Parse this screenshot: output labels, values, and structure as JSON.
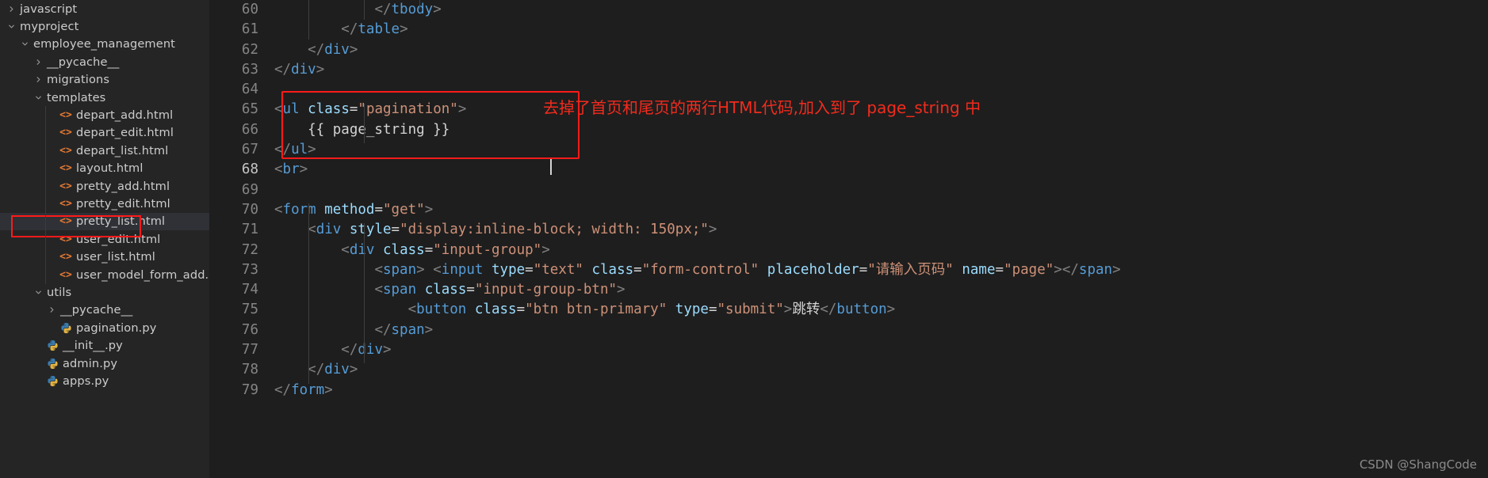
{
  "sidebar": {
    "items": [
      {
        "label": "javascript",
        "indent": 0,
        "twisty": "chevron-right-icon",
        "icon": "folder",
        "type": "folder",
        "selected": false
      },
      {
        "label": "myproject",
        "indent": 0,
        "twisty": "chevron-down-icon",
        "icon": "folder",
        "type": "folder",
        "selected": false
      },
      {
        "label": "employee_management",
        "indent": 1,
        "twisty": "chevron-down-icon",
        "icon": "folder",
        "type": "folder",
        "selected": false
      },
      {
        "label": "__pycache__",
        "indent": 2,
        "twisty": "chevron-right-icon",
        "icon": "folder",
        "type": "folder",
        "selected": false
      },
      {
        "label": "migrations",
        "indent": 2,
        "twisty": "chevron-right-icon",
        "icon": "folder",
        "type": "folder",
        "selected": false
      },
      {
        "label": "templates",
        "indent": 2,
        "twisty": "chevron-down-icon",
        "icon": "folder",
        "type": "folder",
        "selected": false
      },
      {
        "label": "depart_add.html",
        "indent": 3,
        "twisty": "none",
        "icon": "html-file-icon",
        "type": "html",
        "selected": false
      },
      {
        "label": "depart_edit.html",
        "indent": 3,
        "twisty": "none",
        "icon": "html-file-icon",
        "type": "html",
        "selected": false
      },
      {
        "label": "depart_list.html",
        "indent": 3,
        "twisty": "none",
        "icon": "html-file-icon",
        "type": "html",
        "selected": false
      },
      {
        "label": "layout.html",
        "indent": 3,
        "twisty": "none",
        "icon": "html-file-icon",
        "type": "html",
        "selected": false
      },
      {
        "label": "pretty_add.html",
        "indent": 3,
        "twisty": "none",
        "icon": "html-file-icon",
        "type": "html",
        "selected": false
      },
      {
        "label": "pretty_edit.html",
        "indent": 3,
        "twisty": "none",
        "icon": "html-file-icon",
        "type": "html",
        "selected": false
      },
      {
        "label": "pretty_list.html",
        "indent": 3,
        "twisty": "none",
        "icon": "html-file-icon",
        "type": "html",
        "selected": true
      },
      {
        "label": "user_edit.html",
        "indent": 3,
        "twisty": "none",
        "icon": "html-file-icon",
        "type": "html",
        "selected": false
      },
      {
        "label": "user_list.html",
        "indent": 3,
        "twisty": "none",
        "icon": "html-file-icon",
        "type": "html",
        "selected": false
      },
      {
        "label": "user_model_form_add.html",
        "indent": 3,
        "twisty": "none",
        "icon": "html-file-icon",
        "type": "html",
        "selected": false
      },
      {
        "label": "utils",
        "indent": 2,
        "twisty": "chevron-down-icon",
        "icon": "folder",
        "type": "folder",
        "selected": false
      },
      {
        "label": "__pycache__",
        "indent": 3,
        "twisty": "chevron-right-icon",
        "icon": "folder",
        "type": "folder",
        "selected": false
      },
      {
        "label": "pagination.py",
        "indent": 3,
        "twisty": "none",
        "icon": "python-file-icon",
        "type": "python",
        "selected": false
      },
      {
        "label": "__init__.py",
        "indent": 2,
        "twisty": "none",
        "icon": "python-file-icon",
        "type": "python",
        "selected": false
      },
      {
        "label": "admin.py",
        "indent": 2,
        "twisty": "none",
        "icon": "python-file-icon",
        "type": "python",
        "selected": false
      },
      {
        "label": "apps.py",
        "indent": 2,
        "twisty": "none",
        "icon": "python-file-icon",
        "type": "python",
        "selected": false
      }
    ]
  },
  "editor": {
    "first_line_number": 60,
    "current_line_number": 68,
    "lines": [
      {
        "n": "60",
        "tokens": [
          {
            "t": "            ",
            "c": "t-txt"
          },
          {
            "t": "</",
            "c": "t-br"
          },
          {
            "t": "tbody",
            "c": "t-tag"
          },
          {
            "t": ">",
            "c": "t-br"
          }
        ]
      },
      {
        "n": "61",
        "tokens": [
          {
            "t": "        ",
            "c": "t-txt"
          },
          {
            "t": "</",
            "c": "t-br"
          },
          {
            "t": "table",
            "c": "t-tag"
          },
          {
            "t": ">",
            "c": "t-br"
          }
        ]
      },
      {
        "n": "62",
        "tokens": [
          {
            "t": "    ",
            "c": "t-txt"
          },
          {
            "t": "</",
            "c": "t-br"
          },
          {
            "t": "div",
            "c": "t-tag"
          },
          {
            "t": ">",
            "c": "t-br"
          }
        ]
      },
      {
        "n": "63",
        "tokens": [
          {
            "t": "</",
            "c": "t-br"
          },
          {
            "t": "div",
            "c": "t-tag"
          },
          {
            "t": ">",
            "c": "t-br"
          }
        ]
      },
      {
        "n": "64",
        "tokens": []
      },
      {
        "n": "65",
        "tokens": [
          {
            "t": "<",
            "c": "t-br"
          },
          {
            "t": "ul",
            "c": "t-tag"
          },
          {
            "t": " ",
            "c": "t-txt"
          },
          {
            "t": "class",
            "c": "t-attr"
          },
          {
            "t": "=",
            "c": "t-eq"
          },
          {
            "t": "\"pagination\"",
            "c": "t-val"
          },
          {
            "t": ">",
            "c": "t-br"
          }
        ]
      },
      {
        "n": "66",
        "tokens": [
          {
            "t": "    {{ page_string }}",
            "c": "t-tmpl"
          }
        ]
      },
      {
        "n": "67",
        "tokens": [
          {
            "t": "</",
            "c": "t-br"
          },
          {
            "t": "ul",
            "c": "t-tag"
          },
          {
            "t": ">",
            "c": "t-br"
          }
        ]
      },
      {
        "n": "68",
        "tokens": [
          {
            "t": "<",
            "c": "t-br"
          },
          {
            "t": "br",
            "c": "t-tag"
          },
          {
            "t": ">",
            "c": "t-br"
          }
        ]
      },
      {
        "n": "69",
        "tokens": []
      },
      {
        "n": "70",
        "tokens": [
          {
            "t": "<",
            "c": "t-br"
          },
          {
            "t": "form",
            "c": "t-tag"
          },
          {
            "t": " ",
            "c": "t-txt"
          },
          {
            "t": "method",
            "c": "t-attr"
          },
          {
            "t": "=",
            "c": "t-eq"
          },
          {
            "t": "\"get\"",
            "c": "t-val"
          },
          {
            "t": ">",
            "c": "t-br"
          }
        ]
      },
      {
        "n": "71",
        "tokens": [
          {
            "t": "    ",
            "c": "t-txt"
          },
          {
            "t": "<",
            "c": "t-br"
          },
          {
            "t": "div",
            "c": "t-tag"
          },
          {
            "t": " ",
            "c": "t-txt"
          },
          {
            "t": "style",
            "c": "t-attr"
          },
          {
            "t": "=",
            "c": "t-eq"
          },
          {
            "t": "\"display:inline-block; width: 150px;\"",
            "c": "t-val"
          },
          {
            "t": ">",
            "c": "t-br"
          }
        ]
      },
      {
        "n": "72",
        "tokens": [
          {
            "t": "        ",
            "c": "t-txt"
          },
          {
            "t": "<",
            "c": "t-br"
          },
          {
            "t": "div",
            "c": "t-tag"
          },
          {
            "t": " ",
            "c": "t-txt"
          },
          {
            "t": "class",
            "c": "t-attr"
          },
          {
            "t": "=",
            "c": "t-eq"
          },
          {
            "t": "\"input-group\"",
            "c": "t-val"
          },
          {
            "t": ">",
            "c": "t-br"
          }
        ]
      },
      {
        "n": "73",
        "tokens": [
          {
            "t": "            ",
            "c": "t-txt"
          },
          {
            "t": "<",
            "c": "t-br"
          },
          {
            "t": "span",
            "c": "t-tag"
          },
          {
            "t": ">",
            "c": "t-br"
          },
          {
            "t": " ",
            "c": "t-txt"
          },
          {
            "t": "<",
            "c": "t-br"
          },
          {
            "t": "input",
            "c": "t-tag"
          },
          {
            "t": " ",
            "c": "t-txt"
          },
          {
            "t": "type",
            "c": "t-attr"
          },
          {
            "t": "=",
            "c": "t-eq"
          },
          {
            "t": "\"text\"",
            "c": "t-val"
          },
          {
            "t": " ",
            "c": "t-txt"
          },
          {
            "t": "class",
            "c": "t-attr"
          },
          {
            "t": "=",
            "c": "t-eq"
          },
          {
            "t": "\"form-control\"",
            "c": "t-val"
          },
          {
            "t": " ",
            "c": "t-txt"
          },
          {
            "t": "placeholder",
            "c": "t-attr"
          },
          {
            "t": "=",
            "c": "t-eq"
          },
          {
            "t": "\"请输入页码\"",
            "c": "t-val"
          },
          {
            "t": " ",
            "c": "t-txt"
          },
          {
            "t": "name",
            "c": "t-attr"
          },
          {
            "t": "=",
            "c": "t-eq"
          },
          {
            "t": "\"page\"",
            "c": "t-val"
          },
          {
            "t": ">",
            "c": "t-br"
          },
          {
            "t": "</",
            "c": "t-br"
          },
          {
            "t": "span",
            "c": "t-tag"
          },
          {
            "t": ">",
            "c": "t-br"
          }
        ]
      },
      {
        "n": "74",
        "tokens": [
          {
            "t": "            ",
            "c": "t-txt"
          },
          {
            "t": "<",
            "c": "t-br"
          },
          {
            "t": "span",
            "c": "t-tag"
          },
          {
            "t": " ",
            "c": "t-txt"
          },
          {
            "t": "class",
            "c": "t-attr"
          },
          {
            "t": "=",
            "c": "t-eq"
          },
          {
            "t": "\"input-group-btn\"",
            "c": "t-val"
          },
          {
            "t": ">",
            "c": "t-br"
          }
        ]
      },
      {
        "n": "75",
        "tokens": [
          {
            "t": "                ",
            "c": "t-txt"
          },
          {
            "t": "<",
            "c": "t-br"
          },
          {
            "t": "button",
            "c": "t-tag"
          },
          {
            "t": " ",
            "c": "t-txt"
          },
          {
            "t": "class",
            "c": "t-attr"
          },
          {
            "t": "=",
            "c": "t-eq"
          },
          {
            "t": "\"btn btn-primary\"",
            "c": "t-val"
          },
          {
            "t": " ",
            "c": "t-txt"
          },
          {
            "t": "type",
            "c": "t-attr"
          },
          {
            "t": "=",
            "c": "t-eq"
          },
          {
            "t": "\"submit\"",
            "c": "t-val"
          },
          {
            "t": ">",
            "c": "t-br"
          },
          {
            "t": "跳转",
            "c": "t-txt"
          },
          {
            "t": "</",
            "c": "t-br"
          },
          {
            "t": "button",
            "c": "t-tag"
          },
          {
            "t": ">",
            "c": "t-br"
          }
        ]
      },
      {
        "n": "76",
        "tokens": [
          {
            "t": "            ",
            "c": "t-txt"
          },
          {
            "t": "</",
            "c": "t-br"
          },
          {
            "t": "span",
            "c": "t-tag"
          },
          {
            "t": ">",
            "c": "t-br"
          }
        ]
      },
      {
        "n": "77",
        "tokens": [
          {
            "t": "        ",
            "c": "t-txt"
          },
          {
            "t": "</",
            "c": "t-br"
          },
          {
            "t": "div",
            "c": "t-tag"
          },
          {
            "t": ">",
            "c": "t-br"
          }
        ]
      },
      {
        "n": "78",
        "tokens": [
          {
            "t": "    ",
            "c": "t-txt"
          },
          {
            "t": "</",
            "c": "t-br"
          },
          {
            "t": "div",
            "c": "t-tag"
          },
          {
            "t": ">",
            "c": "t-br"
          }
        ]
      },
      {
        "n": "79",
        "tokens": [
          {
            "t": "</",
            "c": "t-br"
          },
          {
            "t": "form",
            "c": "t-tag"
          },
          {
            "t": ">",
            "c": "t-br"
          }
        ]
      }
    ]
  },
  "annotation": {
    "text": "去掉了首页和尾页的两行HTML代码,加入到了 page_string 中",
    "color": "#f22b1d"
  },
  "watermark": {
    "text": "CSDN @ShangCode"
  }
}
